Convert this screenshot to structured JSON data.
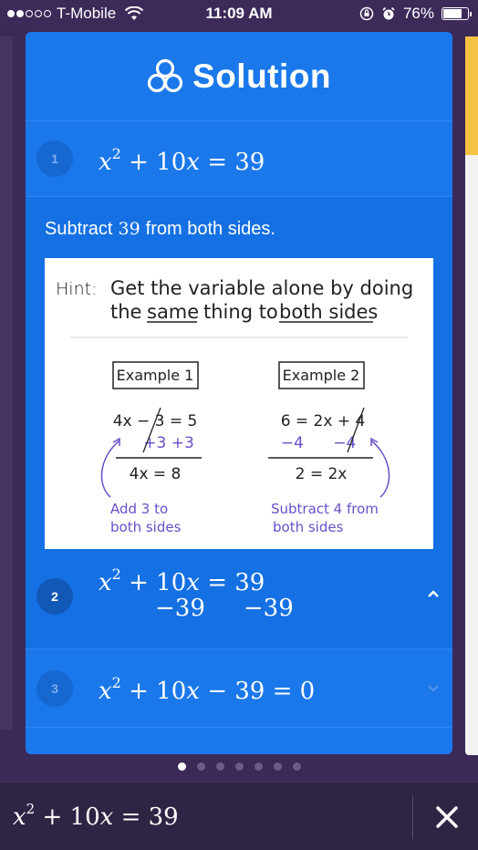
{
  "status_bar": {
    "carrier": "T-Mobile",
    "time": "11:09 AM",
    "battery": "76%",
    "battery_level": 0.76
  },
  "card": {
    "title": "Solution",
    "steps": [
      {
        "number": "1",
        "equation_var": "x",
        "equation_exp": "2",
        "equation_rest": "+ 10",
        "equation_var2": "x",
        "equation_tail": "= 39"
      },
      {
        "number": "2",
        "equation_var": "x",
        "equation_exp": "2",
        "equation_rest": "+ 10",
        "equation_var2": "x",
        "equation_tail": "= 39",
        "second_line_a": "−39",
        "second_line_b": "−39"
      },
      {
        "number": "3",
        "equation_var": "x",
        "equation_exp": "2",
        "equation_rest": "+ 10",
        "equation_var2": "x",
        "equation_tail": "− 39 = 0"
      }
    ],
    "explanation": {
      "before": "Subtract",
      "number": "39",
      "after": "from both sides."
    },
    "hint": {
      "label": "Hint:",
      "line1": "Get the variable alone by doing",
      "line2_a": "the",
      "line2_same": "same",
      "line2_b": "thing to",
      "line2_both": "both sides",
      "example1": {
        "title": "Example 1",
        "eq1": "4x − 3 = 5",
        "eq2": "+3  +3",
        "result": "4x = 8",
        "note1": "Add 3 to",
        "note2": "both sides"
      },
      "example2": {
        "title": "Example 2",
        "eq1": "6 = 2x + 4",
        "eq2": "−4      −4",
        "result": "2 = 2x",
        "note1": "Subtract 4 from",
        "note2": "both sides"
      }
    }
  },
  "pager": {
    "count": 7,
    "active": 0
  },
  "bottom_bar": {
    "equation_var": "x",
    "equation_exp": "2",
    "equation_rest": "+ 10",
    "equation_var2": "x",
    "equation_tail": "= 39"
  },
  "colors": {
    "card": "#1a78ea",
    "explain": "#1470e3",
    "background": "#3b2a57",
    "hint_ink": "#6a4fc8"
  }
}
